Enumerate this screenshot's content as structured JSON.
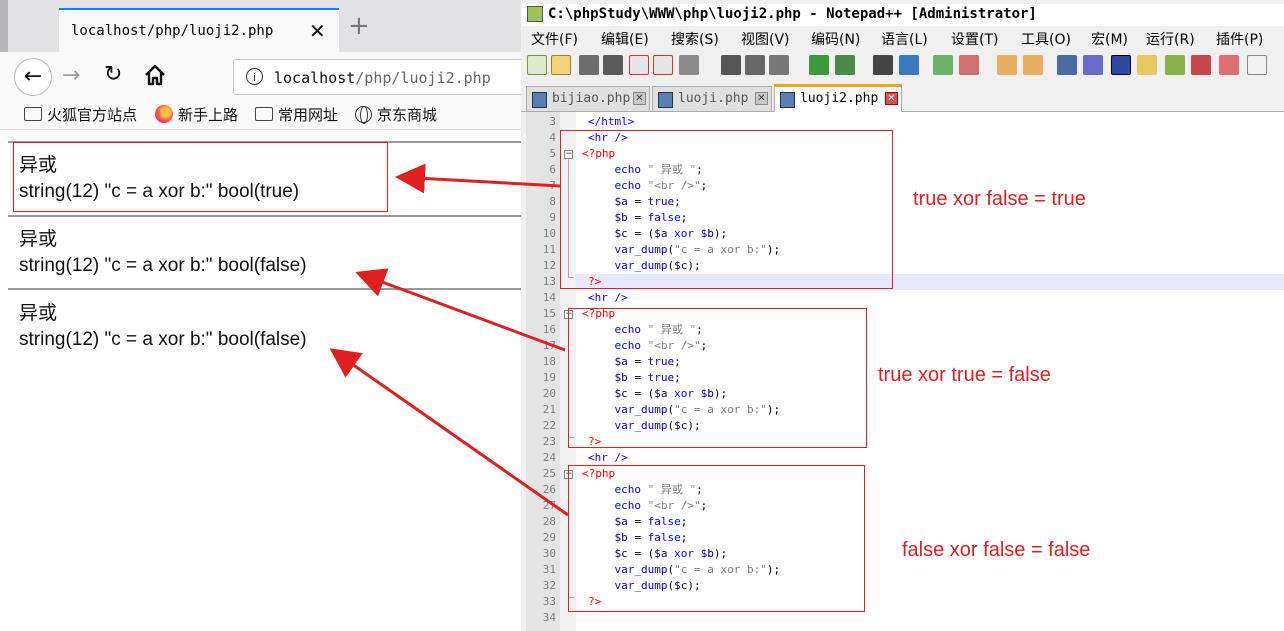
{
  "browser": {
    "tab_title": "localhost/php/luoji2.php",
    "tab_close": "✕",
    "new_tab": "+",
    "url_host": "localhost",
    "url_path": "/php/luoji2.php",
    "bookmarks": [
      "火狐官方站点",
      "新手上路",
      "常用网址",
      "京东商城"
    ],
    "output": [
      {
        "label": "异或",
        "value": "string(12) \"c = a xor b:\" bool(true)"
      },
      {
        "label": "异或",
        "value": "string(12) \"c = a xor b:\" bool(false)"
      },
      {
        "label": "异或",
        "value": "string(12) \"c = a xor b:\" bool(false)"
      }
    ]
  },
  "npp": {
    "title": "C:\\phpStudy\\WWW\\php\\luoji2.php - Notepad++ [Administrator]",
    "menu": [
      "文件(F)",
      "编辑(E)",
      "搜索(S)",
      "视图(V)",
      "编码(N)",
      "语言(L)",
      "设置(T)",
      "工具(O)",
      "宏(M)",
      "运行(R)",
      "插件(P)"
    ],
    "tabs": [
      "bijiao.php",
      "luoji.php",
      "luoji2.php"
    ],
    "active_tab": 2,
    "line_numbers": [
      "3",
      "4",
      "5",
      "6",
      "7",
      "8",
      "9",
      "10",
      "11",
      "12",
      "13",
      "14",
      "15",
      "16",
      "17",
      "18",
      "19",
      "20",
      "21",
      "22",
      "23",
      "24",
      "25",
      "26",
      "27",
      "28",
      "29",
      "30",
      "31",
      "32",
      "33",
      "34"
    ]
  },
  "annotations": [
    "true xor false = true",
    "true xor true = false",
    "false xor false = false"
  ],
  "colors": {
    "annotation": "#e02020",
    "tab_accent": "#f6a01a",
    "keyword": "#0000ff",
    "php_tag": "#ff0000"
  }
}
